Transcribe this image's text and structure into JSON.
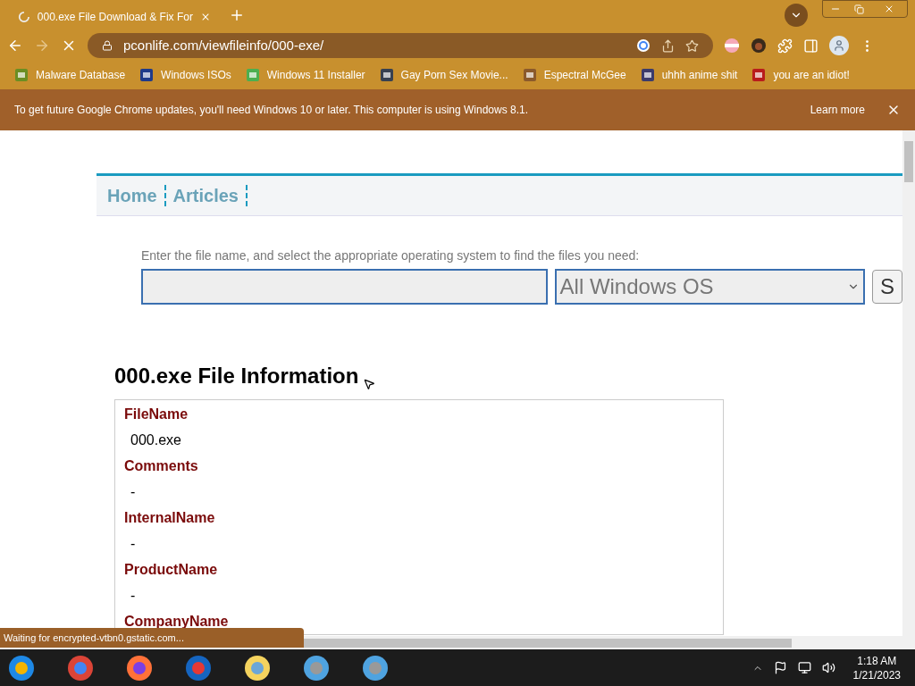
{
  "tab": {
    "title": "000.exe File Download & Fix For",
    "loading": true
  },
  "address": {
    "url": "pconlife.com/viewfileinfo/000-exe/"
  },
  "bookmarks": [
    {
      "label": "Malware Database"
    },
    {
      "label": "Windows ISOs"
    },
    {
      "label": "Windows 11 Installer"
    },
    {
      "label": "Gay Porn Sex Movie..."
    },
    {
      "label": "Espectral McGee"
    },
    {
      "label": "uhhh anime shit"
    },
    {
      "label": "you are an idiot!"
    }
  ],
  "infobar": {
    "message": "To get future Google Chrome updates, you'll need Windows 10 or later. This computer is using Windows 8.1.",
    "link": "Learn more"
  },
  "nav": [
    {
      "label": "Home"
    },
    {
      "label": "Articles"
    }
  ],
  "search": {
    "prompt": "Enter the file name, and select the appropriate operating system to find the files you need:",
    "os": "All Windows OS",
    "button": "S"
  },
  "heading": "000.exe File Information",
  "fields": [
    {
      "name": "FileName",
      "value": "000.exe"
    },
    {
      "name": "Comments",
      "value": "-"
    },
    {
      "name": "InternalName",
      "value": "-"
    },
    {
      "name": "ProductName",
      "value": "-"
    },
    {
      "name": "CompanyName"
    }
  ],
  "status": "Waiting for encrypted-vtbn0.gstatic.com...",
  "clock": {
    "time": "1:18 AM",
    "date": "1/21/2023"
  }
}
